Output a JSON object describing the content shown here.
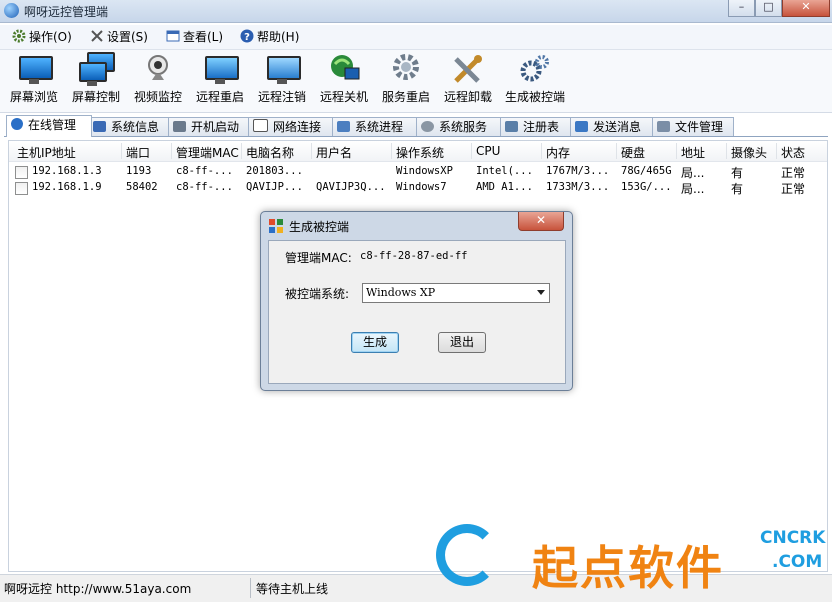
{
  "window": {
    "title": "啊呀远控管理端"
  },
  "menu": [
    {
      "label": "操作(O)",
      "icon": "gear-icon",
      "color": "#4a7a2a"
    },
    {
      "label": "设置(S)",
      "icon": "tools-icon",
      "color": "#666666"
    },
    {
      "label": "查看(L)",
      "icon": "view-icon",
      "color": "#3a6ab5"
    },
    {
      "label": "帮助(H)",
      "icon": "help-icon",
      "color": "#2a5db0"
    }
  ],
  "toolbar": [
    {
      "label": "屏幕浏览",
      "icon": "monitor-icon"
    },
    {
      "label": "屏幕控制",
      "icon": "monitors-icon"
    },
    {
      "label": "视频监控",
      "icon": "webcam-icon"
    },
    {
      "label": "远程重启",
      "icon": "restart-icon"
    },
    {
      "label": "远程注销",
      "icon": "logoff-icon"
    },
    {
      "label": "远程关机",
      "icon": "shutdown-icon"
    },
    {
      "label": "服务重启",
      "icon": "service-gear-icon"
    },
    {
      "label": "远程卸载",
      "icon": "uninstall-tools-icon"
    },
    {
      "label": "生成被控端",
      "icon": "build-gears-icon"
    }
  ],
  "tabs": [
    {
      "label": "在线管理",
      "active": true
    },
    {
      "label": "系统信息"
    },
    {
      "label": "开机启动"
    },
    {
      "label": "网络连接"
    },
    {
      "label": "系统进程"
    },
    {
      "label": "系统服务"
    },
    {
      "label": "注册表"
    },
    {
      "label": "发送消息"
    },
    {
      "label": "文件管理"
    }
  ],
  "table": {
    "columns": [
      "主机IP地址",
      "端口",
      "管理端MAC",
      "电脑名称",
      "用户名",
      "操作系统",
      "CPU",
      "内存",
      "硬盘",
      "地址",
      "摄像头",
      "状态"
    ],
    "rows": [
      [
        "192.168.1.3",
        "1193",
        "c8-ff-...",
        "201803...",
        "",
        "WindowsXP",
        "Intel(...",
        "1767M/3...",
        "78G/465G",
        "局...",
        "有",
        "正常"
      ],
      [
        "192.168.1.9",
        "58402",
        "c8-ff-...",
        "QAVIJP...",
        "QAVIJP3Q...",
        "Windows7",
        "AMD A1...",
        "1733M/3...",
        "153G/...",
        "局...",
        "有",
        "正常"
      ]
    ]
  },
  "dialog": {
    "title": "生成被控端",
    "mac_label": "管理端MAC:",
    "mac_value": "c8-ff-28-87-ed-ff",
    "os_label": "被控端系统:",
    "os_value": "Windows XP",
    "generate_label": "生成",
    "exit_label": "退出"
  },
  "status": {
    "left": "啊呀远控 http://www.51aya.com",
    "right": "等待主机上线"
  },
  "watermark": {
    "text": "起点软件",
    "badge_top": "CNCRK",
    "badge_bottom": ".COM"
  }
}
